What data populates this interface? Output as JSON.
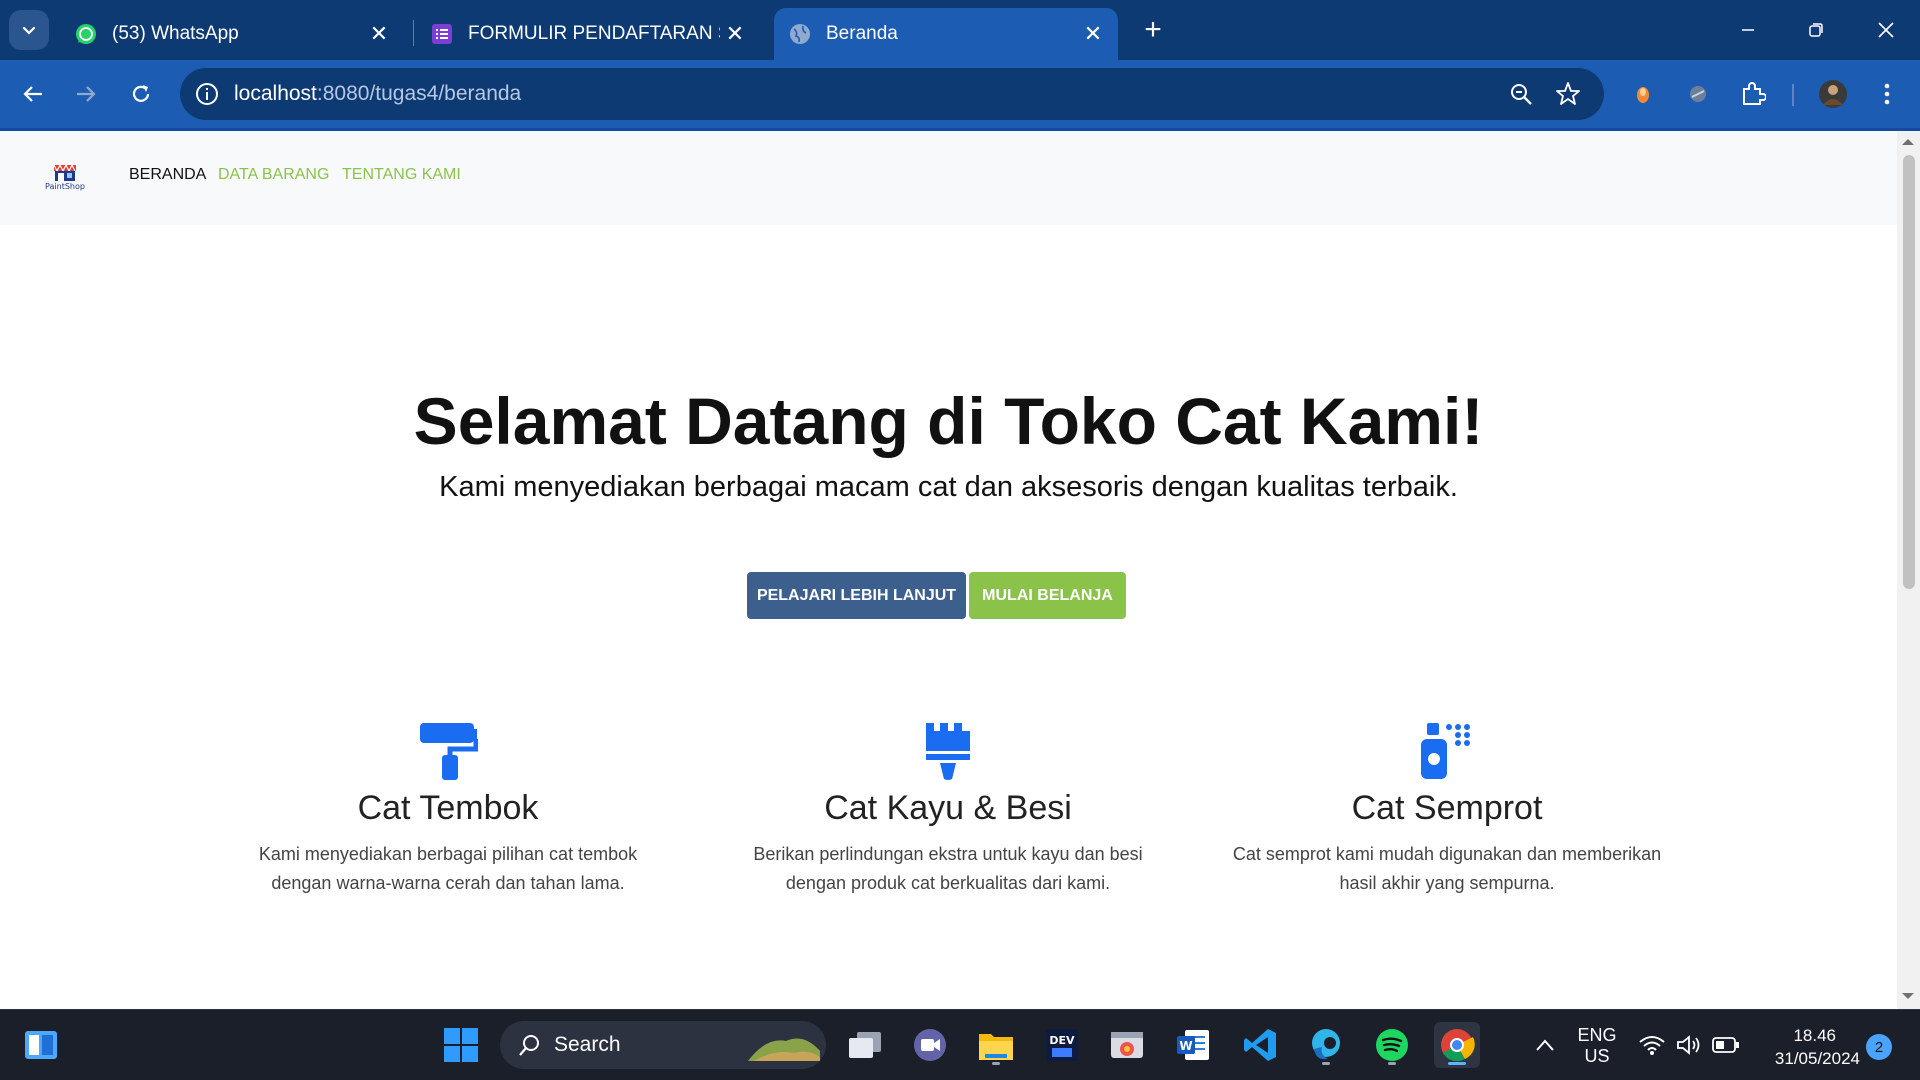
{
  "browser": {
    "tabs": [
      {
        "title": "(53) WhatsApp",
        "active": false
      },
      {
        "title": "FORMULIR PENDAFTARAN SMF",
        "active": false
      },
      {
        "title": "Beranda",
        "active": true
      }
    ],
    "url_host": "localhost",
    "url_path": ":8080/tugas4/beranda",
    "colors": {
      "tabstrip": "#0e3a73",
      "toolbar": "#1d5cb3"
    }
  },
  "site": {
    "logo_text": "PaintShop",
    "nav": [
      {
        "label": "BERANDA",
        "active": true
      },
      {
        "label": "DATA BARANG",
        "active": false
      },
      {
        "label": "TENTANG KAMI",
        "active": false
      }
    ],
    "hero": {
      "title": "Selamat Datang di Toko Cat Kami!",
      "subtitle": "Kami menyediakan berbagai macam cat dan aksesoris dengan kualitas terbaik.",
      "primary_button": "PELAJARI LEBIH LANJUT",
      "secondary_button": "MULAI BELANJA"
    },
    "features": [
      {
        "icon": "paint-roller-icon",
        "title": "Cat Tembok",
        "line1": "Kami menyediakan berbagai pilihan cat tembok",
        "line2": "dengan warna-warna cerah dan tahan lama."
      },
      {
        "icon": "paint-brush-icon",
        "title": "Cat Kayu & Besi",
        "line1": "Berikan perlindungan ekstra untuk kayu dan besi",
        "line2": "dengan produk cat berkualitas dari kami."
      },
      {
        "icon": "spray-can-icon",
        "title": "Cat Semprot",
        "line1": "Cat semprot kami mudah digunakan dan memberikan",
        "line2": "hasil akhir yang sempurna."
      }
    ],
    "colors": {
      "primary": "#3c5f8d",
      "success": "#8bc34a",
      "icon_blue": "#1a6cf0"
    }
  },
  "taskbar": {
    "search_label": "Search",
    "language_line1": "ENG",
    "language_line2": "US",
    "time": "18.46",
    "date": "31/05/2024",
    "notification_count": "2"
  }
}
